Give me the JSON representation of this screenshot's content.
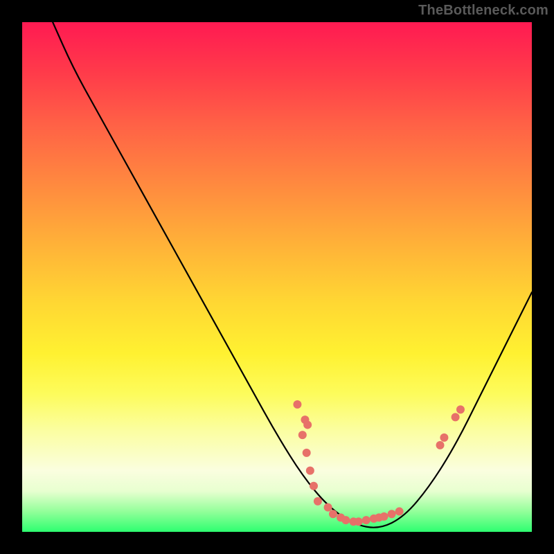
{
  "watermark": "TheBottleneck.com",
  "chart_data": {
    "type": "line",
    "title": "",
    "xlabel": "",
    "ylabel": "",
    "xlim": [
      0,
      100
    ],
    "ylim": [
      0,
      100
    ],
    "grid": false,
    "background_gradient": {
      "stops": [
        {
          "pos": 0,
          "color": "#ff1a52"
        },
        {
          "pos": 10,
          "color": "#ff3b4a"
        },
        {
          "pos": 20,
          "color": "#ff6146"
        },
        {
          "pos": 32,
          "color": "#ff8a3f"
        },
        {
          "pos": 44,
          "color": "#ffb338"
        },
        {
          "pos": 55,
          "color": "#ffd733"
        },
        {
          "pos": 65,
          "color": "#fff131"
        },
        {
          "pos": 73,
          "color": "#fdfc5c"
        },
        {
          "pos": 80,
          "color": "#fbfea0"
        },
        {
          "pos": 88,
          "color": "#fafedf"
        },
        {
          "pos": 92,
          "color": "#e8ffd0"
        },
        {
          "pos": 96,
          "color": "#93ff9a"
        },
        {
          "pos": 100,
          "color": "#2dff70"
        }
      ]
    },
    "series": [
      {
        "name": "bottleneck-curve",
        "type": "line",
        "color": "#000000",
        "points": [
          {
            "x": 6.0,
            "y": 100.0
          },
          {
            "x": 10.0,
            "y": 91.0
          },
          {
            "x": 15.0,
            "y": 82.0
          },
          {
            "x": 20.0,
            "y": 73.0
          },
          {
            "x": 25.0,
            "y": 64.0
          },
          {
            "x": 30.0,
            "y": 55.0
          },
          {
            "x": 35.0,
            "y": 46.0
          },
          {
            "x": 40.0,
            "y": 37.0
          },
          {
            "x": 45.0,
            "y": 28.0
          },
          {
            "x": 50.0,
            "y": 19.0
          },
          {
            "x": 55.0,
            "y": 11.0
          },
          {
            "x": 60.0,
            "y": 5.0
          },
          {
            "x": 65.0,
            "y": 1.5
          },
          {
            "x": 70.0,
            "y": 0.5
          },
          {
            "x": 75.0,
            "y": 3.0
          },
          {
            "x": 80.0,
            "y": 9.0
          },
          {
            "x": 85.0,
            "y": 17.0
          },
          {
            "x": 90.0,
            "y": 27.0
          },
          {
            "x": 95.0,
            "y": 37.0
          },
          {
            "x": 100.0,
            "y": 47.0
          }
        ]
      },
      {
        "name": "data-points",
        "type": "scatter",
        "color": "#e77169",
        "radius": 6,
        "points": [
          {
            "x": 54.0,
            "y": 25.0
          },
          {
            "x": 55.5,
            "y": 22.0
          },
          {
            "x": 56.0,
            "y": 21.0
          },
          {
            "x": 55.0,
            "y": 19.0
          },
          {
            "x": 55.8,
            "y": 15.5
          },
          {
            "x": 56.5,
            "y": 12.0
          },
          {
            "x": 57.2,
            "y": 9.0
          },
          {
            "x": 58.0,
            "y": 6.0
          },
          {
            "x": 60.0,
            "y": 4.8
          },
          {
            "x": 61.0,
            "y": 3.5
          },
          {
            "x": 62.5,
            "y": 2.8
          },
          {
            "x": 63.5,
            "y": 2.3
          },
          {
            "x": 65.0,
            "y": 2.0
          },
          {
            "x": 66.0,
            "y": 2.0
          },
          {
            "x": 67.5,
            "y": 2.3
          },
          {
            "x": 69.0,
            "y": 2.6
          },
          {
            "x": 70.0,
            "y": 2.8
          },
          {
            "x": 71.0,
            "y": 3.0
          },
          {
            "x": 72.5,
            "y": 3.5
          },
          {
            "x": 74.0,
            "y": 4.0
          },
          {
            "x": 82.0,
            "y": 17.0
          },
          {
            "x": 82.8,
            "y": 18.5
          },
          {
            "x": 85.0,
            "y": 22.5
          },
          {
            "x": 86.0,
            "y": 24.0
          }
        ]
      }
    ]
  }
}
